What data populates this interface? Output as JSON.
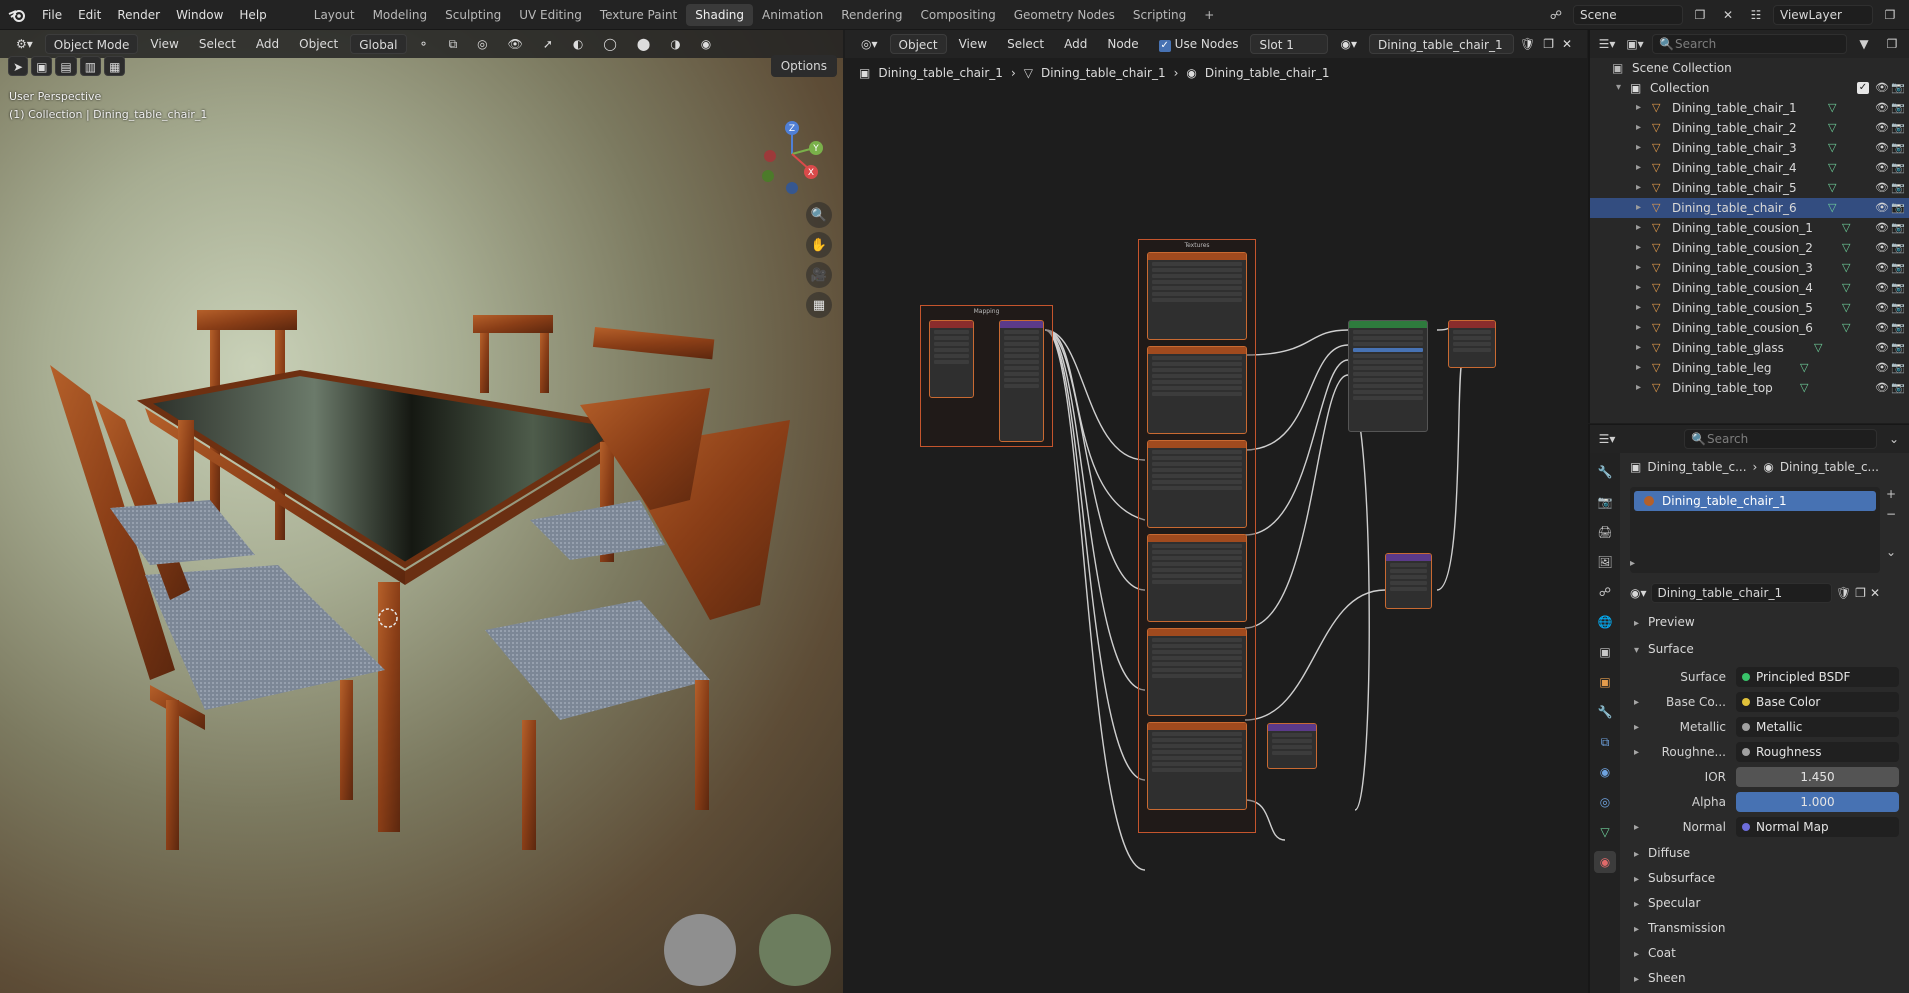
{
  "topbar": {
    "menus": [
      "File",
      "Edit",
      "Render",
      "Window",
      "Help"
    ],
    "workspaces": [
      "Layout",
      "Modeling",
      "Sculpting",
      "UV Editing",
      "Texture Paint",
      "Shading",
      "Animation",
      "Rendering",
      "Compositing",
      "Geometry Nodes",
      "Scripting"
    ],
    "active_workspace": "Shading",
    "add_tab": "+",
    "scene": "Scene",
    "view_layer": "ViewLayer"
  },
  "viewport": {
    "mode": "Object Mode",
    "menus": [
      "View",
      "Select",
      "Add",
      "Object"
    ],
    "orientation": "Global",
    "options": "Options",
    "view_name": "User Perspective",
    "collection_info": "(1) Collection | Dining_table_chair_1",
    "gizmo_axes": [
      "Z",
      "Y",
      "X"
    ]
  },
  "node_editor": {
    "type": "Object",
    "menus": [
      "View",
      "Select",
      "Add",
      "Node"
    ],
    "use_nodes": "Use Nodes",
    "slot": "Slot 1",
    "material": "Dining_table_chair_1",
    "breadcrumb": [
      "Dining_table_chair_1",
      "Dining_table_chair_1",
      "Dining_table_chair_1"
    ],
    "frames": [
      "Mapping",
      "Textures"
    ]
  },
  "outliner": {
    "search_placeholder": "Search",
    "scene_collection": "Scene Collection",
    "collection": "Collection",
    "objects": [
      "Dining_table_chair_1",
      "Dining_table_chair_2",
      "Dining_table_chair_3",
      "Dining_table_chair_4",
      "Dining_table_chair_5",
      "Dining_table_chair_6",
      "Dining_table_cousion_1",
      "Dining_table_cousion_2",
      "Dining_table_cousion_3",
      "Dining_table_cousion_4",
      "Dining_table_cousion_5",
      "Dining_table_cousion_6",
      "Dining_table_glass",
      "Dining_table_leg",
      "Dining_table_top"
    ],
    "selected_index": 5
  },
  "properties": {
    "search_placeholder": "Search",
    "path": [
      "Dining_table_c...",
      "Dining_table_c..."
    ],
    "material_slot": "Dining_table_chair_1",
    "material_name": "Dining_table_chair_1",
    "sections": {
      "preview": "Preview",
      "surface": "Surface"
    },
    "surface_rows": [
      {
        "label": "Surface",
        "value": "Principled BSDF",
        "color": "#39c36a"
      },
      {
        "label": "Base Co...",
        "value": "Base Color",
        "color": "#e0c13a"
      },
      {
        "label": "Metallic",
        "value": "Metallic",
        "color": "#a0a0a0"
      },
      {
        "label": "Roughne...",
        "value": "Roughness",
        "color": "#a0a0a0"
      },
      {
        "label": "IOR",
        "value": "1.450",
        "color": "#a0a0a0"
      },
      {
        "label": "Alpha",
        "value": "1.000",
        "color": "#a0a0a0"
      },
      {
        "label": "Normal",
        "value": "Normal Map",
        "color": "#6d6ddb"
      }
    ],
    "collapsed_sections": [
      "Diffuse",
      "Subsurface",
      "Specular",
      "Transmission",
      "Coat",
      "Sheen"
    ]
  },
  "colors": {
    "accent": "#4772b3",
    "selected_row": "#334d80",
    "node_border": "#c96a32",
    "mesh_icon": "#6fd09b",
    "object_icon": "#e59c4c"
  }
}
